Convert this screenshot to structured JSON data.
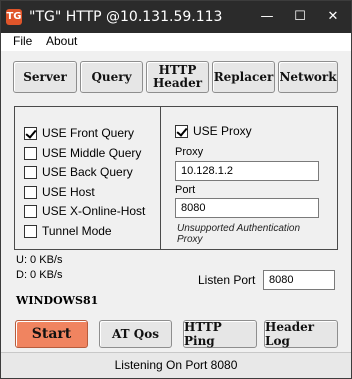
{
  "titlebar": {
    "app_icon": "tg-app-icon",
    "title": "\"TG\" HTTP @10.131.59.113",
    "minimize": "—",
    "maximize": "☐",
    "close": "✕"
  },
  "menu": {
    "file": "File",
    "about": "About"
  },
  "toolbar": {
    "server": "Server",
    "query": "Query",
    "http_header_line1": "HTTP",
    "http_header_line2": "Header",
    "replacer": "Replacer",
    "network": "Network"
  },
  "options": {
    "use_front_query": {
      "label": "USE Front Query",
      "checked": true
    },
    "use_middle_query": {
      "label": "USE Middle Query",
      "checked": false
    },
    "use_back_query": {
      "label": "USE Back Query",
      "checked": false
    },
    "use_host": {
      "label": "USE Host",
      "checked": false
    },
    "use_x_online_host": {
      "label": "USE X-Online-Host",
      "checked": false
    },
    "tunnel_mode": {
      "label": "Tunnel Mode",
      "checked": false
    }
  },
  "proxy": {
    "use_proxy": {
      "label": "USE Proxy",
      "checked": true
    },
    "proxy_label": "Proxy",
    "proxy_value": "10.128.1.2",
    "port_label": "Port",
    "port_value": "8080",
    "note_line1": "Unsupported Authentication",
    "note_line2": "Proxy"
  },
  "stats": {
    "upload": "U:   0 KB/s",
    "download": "D:   0 KB/s"
  },
  "listen": {
    "label": "Listen Port",
    "value": "8080"
  },
  "host_name": "WINDOWS81",
  "actions": {
    "start": "Start",
    "at_qos": "AT Qos",
    "http_ping": "HTTP Ping",
    "header_log": "Header Log"
  },
  "status": "Listening On Port 8080",
  "colors": {
    "titlebar": "#2b2b2b",
    "start_button": "#f08460",
    "app_icon": "#e0552a"
  }
}
